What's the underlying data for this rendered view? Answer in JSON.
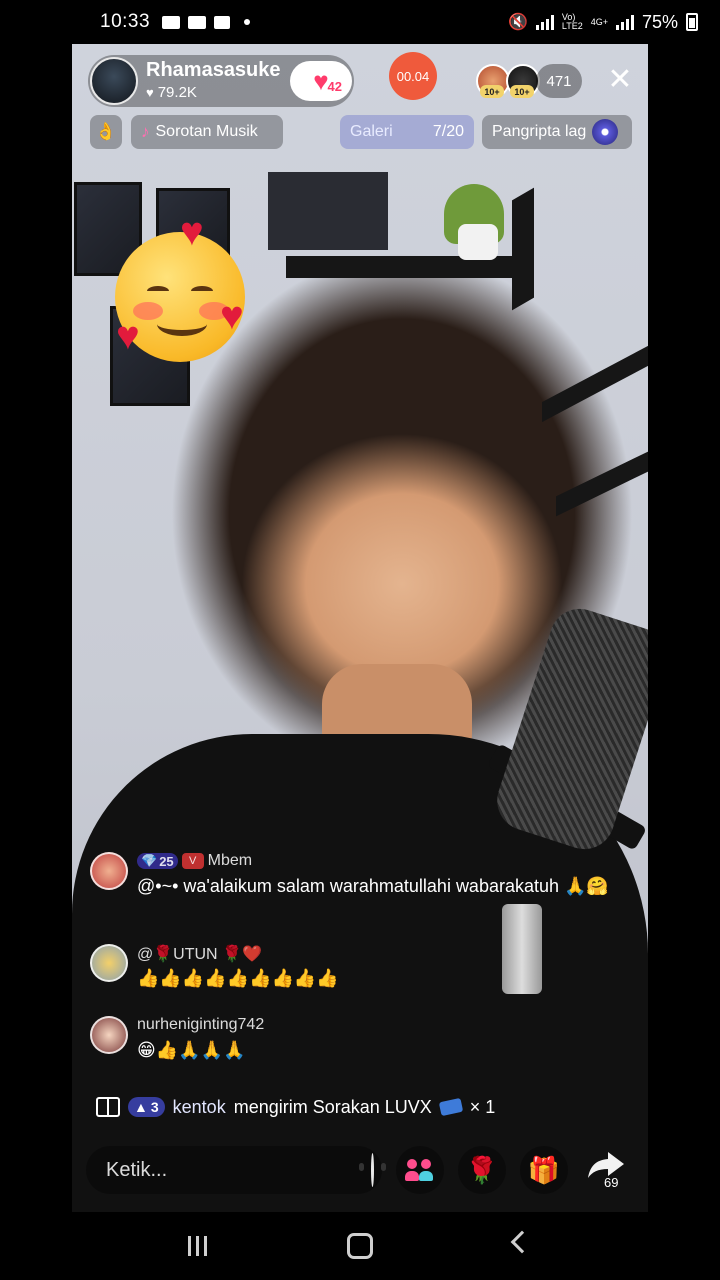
{
  "status_bar": {
    "time": "10:33",
    "battery": "75%",
    "network_labels": [
      "Vo)",
      "LTE2",
      "4G+"
    ]
  },
  "host": {
    "name": "Rhamasasuke",
    "likes": "79.2K",
    "follow_count": "42"
  },
  "timer": "00.04",
  "viewers": {
    "badges": [
      "10+",
      "10+"
    ],
    "count": "471"
  },
  "chips": {
    "music_label": "Sorotan Musik",
    "gallery_label": "Galeri",
    "gallery_count": "7/20",
    "song_label": "Pangripta lag"
  },
  "comments": [
    {
      "level": "25",
      "username": "Mbem",
      "text": "@•~• wa'alaikum salam warahmatullahi wabarakatuh 🙏🤗"
    },
    {
      "level": "",
      "username": "@🌹UTUN 🌹❤️",
      "text": "👍👍👍👍👍👍👍👍👍"
    },
    {
      "level": "",
      "username": "nurheniginting742",
      "text": "😁👍🙏🙏🙏"
    }
  ],
  "gift_notice": {
    "level": "3",
    "username": "kentok",
    "text": "mengirim Sorakan LUVX",
    "multiplier": "× 1"
  },
  "input": {
    "placeholder": "Ketik..."
  },
  "share_count": "69",
  "icons": {
    "close": "close-icon",
    "heart": "heart-icon",
    "music": "music-note-icon",
    "gift": "gift-icon",
    "rose": "rose-icon",
    "share": "share-icon",
    "people": "guests-icon",
    "emoji": "emoji-icon"
  },
  "colors": {
    "timer_bg": "#ef5a3c",
    "accent_pink": "#ff4d8d",
    "level_badge": "#5b59d9"
  }
}
